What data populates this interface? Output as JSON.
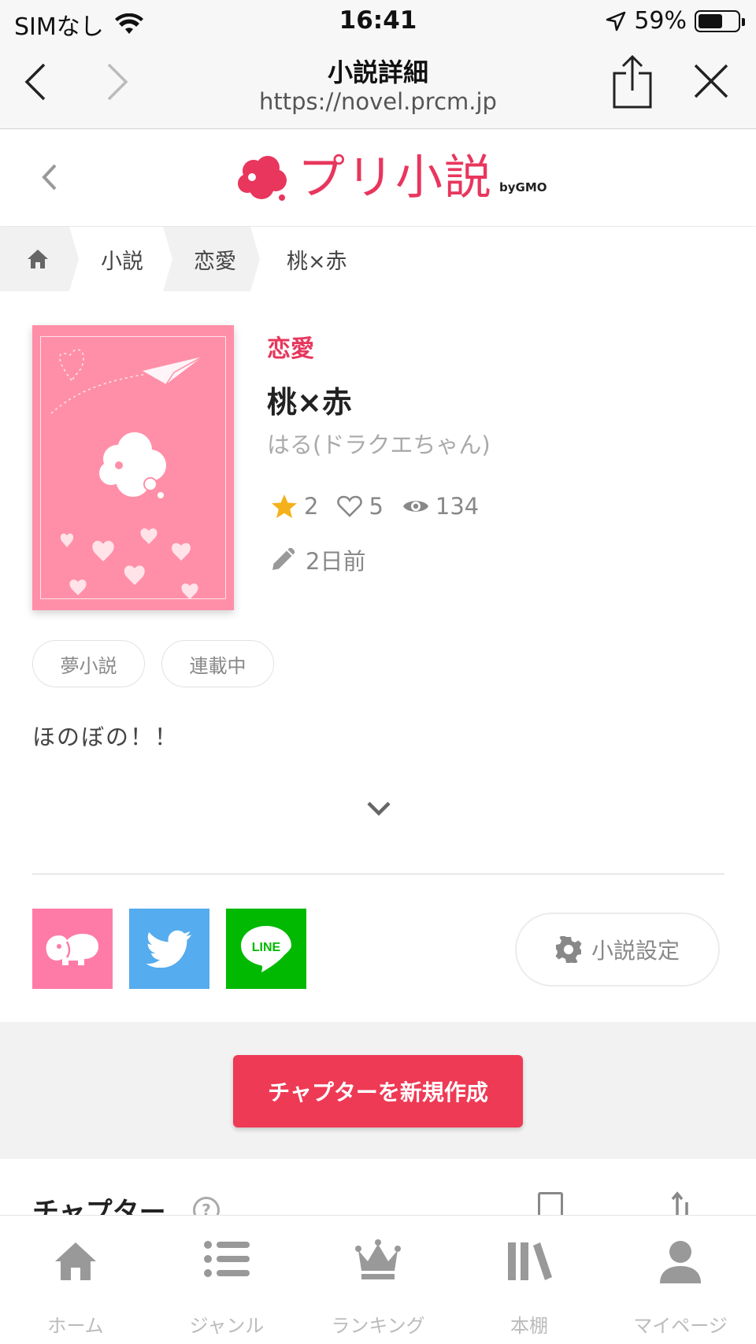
{
  "status_bar": {
    "carrier": "SIMなし",
    "time": "16:41",
    "battery": "59%"
  },
  "browser": {
    "title": "小説詳細",
    "url": "https://novel.prcm.jp"
  },
  "site": {
    "logo_text": "プリ小説",
    "logo_by": "byGMO",
    "brand_color": "#e8365d"
  },
  "breadcrumb": {
    "items": [
      "小説",
      "恋愛",
      "桃×赤"
    ]
  },
  "novel": {
    "genre": "恋愛",
    "title": "桃×赤",
    "author": "はる(ドラクエちゃん)",
    "stars": "2",
    "likes": "5",
    "views": "134",
    "updated": "2日前",
    "tags": [
      "夢小説",
      "連載中"
    ],
    "description": "ほのぼの！！"
  },
  "share": {
    "line_label": "LINE"
  },
  "settings_label": "小説設定",
  "cta_label": "チャプターを新規作成",
  "chapter_header": "チャプター",
  "tabbar": {
    "items": [
      {
        "label": "ホーム",
        "icon": "home-icon"
      },
      {
        "label": "ジャンル",
        "icon": "list-icon"
      },
      {
        "label": "ランキング",
        "icon": "crown-icon"
      },
      {
        "label": "本棚",
        "icon": "bookshelf-icon"
      },
      {
        "label": "マイページ",
        "icon": "person-icon"
      }
    ]
  }
}
